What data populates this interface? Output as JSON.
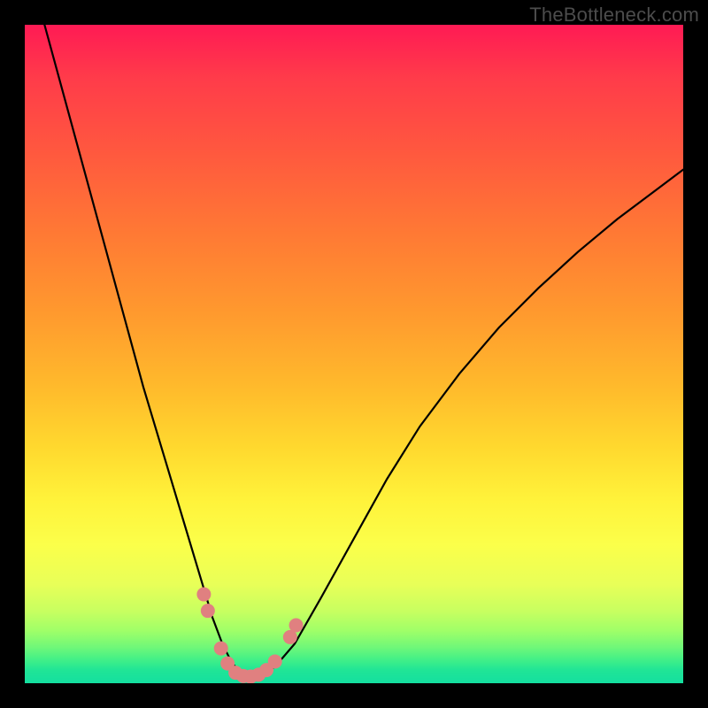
{
  "watermark": "TheBottleneck.com",
  "colors": {
    "page_bg": "#000000",
    "curve": "#000000",
    "marker_fill": "#e08080",
    "marker_stroke": "#c06060"
  },
  "chart_data": {
    "type": "line",
    "title": "",
    "xlabel": "",
    "ylabel": "",
    "xlim": [
      0,
      100
    ],
    "ylim": [
      0,
      100
    ],
    "grid": false,
    "legend": false,
    "series": [
      {
        "name": "bottleneck-curve",
        "x": [
          3,
          6,
          9,
          12,
          15,
          18,
          21,
          24,
          27,
          28.5,
          30,
          31.5,
          33,
          34.5,
          36,
          38,
          41,
          45,
          50,
          55,
          60,
          66,
          72,
          78,
          84,
          90,
          96,
          100
        ],
        "values": [
          100,
          89,
          78,
          67,
          56,
          45,
          35,
          25,
          15,
          10,
          6,
          3,
          1.5,
          1,
          1.2,
          2.5,
          6,
          13,
          22,
          31,
          39,
          47,
          54,
          60,
          65.5,
          70.5,
          75,
          78
        ]
      }
    ],
    "markers": [
      {
        "x": 27.2,
        "y": 13.5
      },
      {
        "x": 27.8,
        "y": 11.0
      },
      {
        "x": 29.8,
        "y": 5.3
      },
      {
        "x": 30.8,
        "y": 3.0
      },
      {
        "x": 32.0,
        "y": 1.6
      },
      {
        "x": 33.2,
        "y": 1.1
      },
      {
        "x": 34.3,
        "y": 1.0
      },
      {
        "x": 35.5,
        "y": 1.3
      },
      {
        "x": 36.7,
        "y": 2.0
      },
      {
        "x": 38.0,
        "y": 3.3
      },
      {
        "x": 40.3,
        "y": 7.0
      },
      {
        "x": 41.2,
        "y": 8.8
      }
    ],
    "marker_radius_px": 8
  }
}
